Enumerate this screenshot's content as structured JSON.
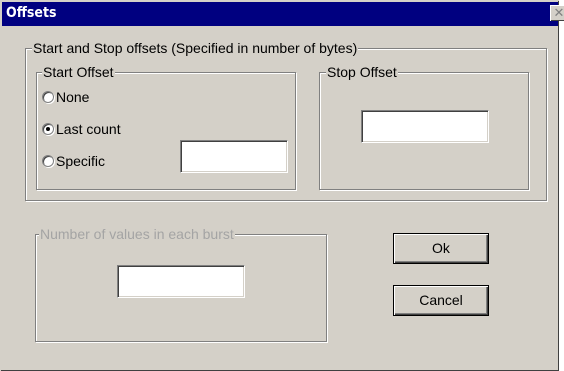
{
  "window": {
    "title": "Offsets",
    "close_glyph": "✕"
  },
  "offsets_group": {
    "label": "Start and Stop offsets (Specified in number of bytes)"
  },
  "start_offset": {
    "label": "Start Offset",
    "options": [
      {
        "label": "None",
        "checked": false
      },
      {
        "label": "Last count",
        "checked": true
      },
      {
        "label": "Specific",
        "checked": false
      }
    ],
    "specific_value": ""
  },
  "stop_offset": {
    "label": "Stop Offset",
    "value": ""
  },
  "burst_group": {
    "label": "Number of values in each burst",
    "value": "",
    "enabled": false
  },
  "buttons": {
    "ok": "Ok",
    "cancel": "Cancel"
  }
}
